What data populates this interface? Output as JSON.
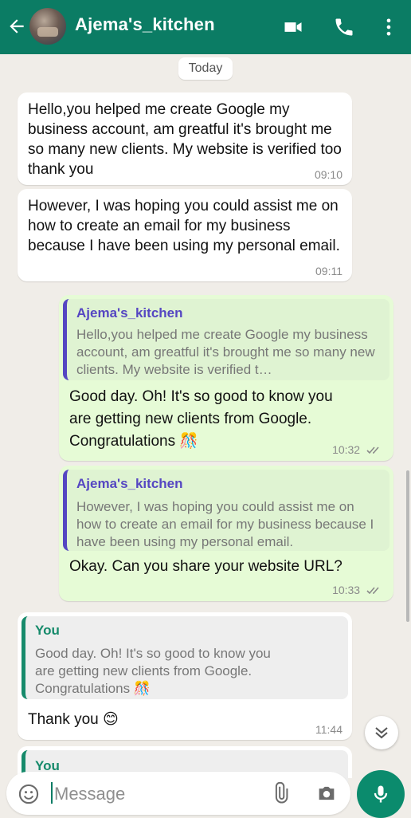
{
  "header": {
    "contact_name": "Ajema's_kitchen",
    "icons": [
      "back-arrow-icon",
      "video-call-icon",
      "phone-icon",
      "more-vertical-icon"
    ]
  },
  "date_divider": "Today",
  "messages": [
    {
      "direction": "incoming",
      "text": "Hello,you helped me create Google my business account, am greatful it's brought me so many new clients. My website is verified too thank you",
      "time": "09:10"
    },
    {
      "direction": "incoming",
      "text": "However, I was hoping you could assist me on how to create an email for my business because I have been using my personal email.",
      "time": "09:11"
    },
    {
      "direction": "outgoing",
      "quote_author": "Ajema's_kitchen",
      "quote_text": "Hello,you helped me create Google my business account, am greatful it's brought me so many new clients. My website is verified t…",
      "text": "Good day. Oh! It's so good to know you are getting new clients from Google. Congratulations 🎊",
      "time": "10:32",
      "status": "delivered"
    },
    {
      "direction": "outgoing",
      "quote_author": "Ajema's_kitchen",
      "quote_text": "However, I was hoping you could assist me on how to create an email for my business because I have been using my personal email.",
      "text": "Okay. Can you share your website URL?",
      "time": "10:33",
      "status": "delivered"
    },
    {
      "direction": "incoming",
      "quote_author": "You",
      "quote_text": "Good day. Oh! It's so good to know you are getting new clients from Google. Congratulations 🎊",
      "text": "Thank you 😊",
      "time": "11:44"
    },
    {
      "direction": "incoming",
      "quote_author": "You"
    }
  ],
  "composer": {
    "placeholder": "Message",
    "icons": [
      "emoji-icon",
      "attach-icon",
      "camera-icon",
      "mic-icon"
    ]
  },
  "colors": {
    "header": "#0b7c64",
    "background": "#f0ede8",
    "outgoing_bubble": "#e6fbd6",
    "incoming_bubble": "#ffffff",
    "quote_accent_contact": "#5546c2",
    "quote_accent_you": "#168a6b"
  }
}
